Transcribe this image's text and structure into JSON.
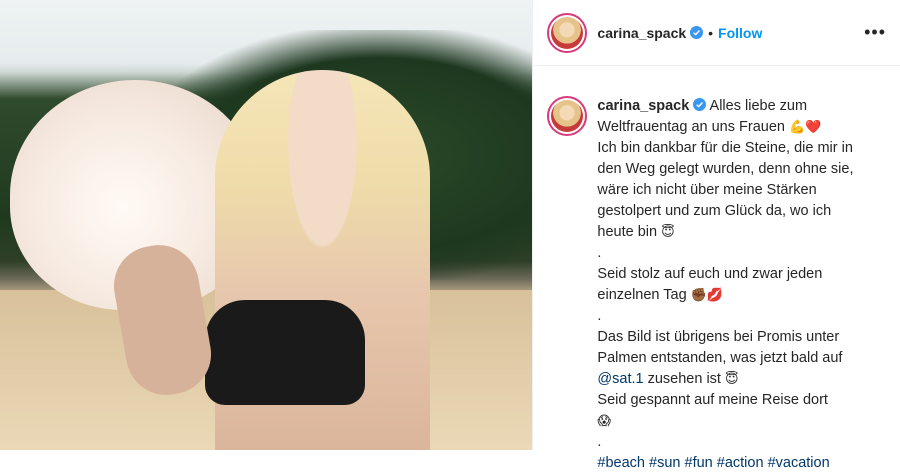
{
  "post": {
    "username": "carina_spack",
    "separator": "•",
    "follow_label": "Follow",
    "more_icon": "more-options-icon",
    "more_glyph": "•••"
  },
  "caption": {
    "username": "carina_spack",
    "line1": " Alles liebe zum Weltfrauentag an uns Frauen ",
    "line1_emoji": "💪❤️",
    "line2": "Ich bin dankbar für die Steine, die mir in den Weg gelegt wurden, denn ohne sie, wäre ich nicht über meine Stärken gestolpert und zum Glück da, wo ich heute bin ",
    "line2_emoji": "😇",
    "dot1": ".",
    "line3": "Seid stolz auf euch und zwar jeden einzelnen Tag ",
    "line3_emoji": "✊🏾💋",
    "dot2": ".",
    "line4a": "Das Bild ist übrigens bei Promis unter Palmen entstanden, was jetzt bald auf ",
    "mention": "@sat.1",
    "line4b": " zusehen ist ",
    "line4_emoji": "😇",
    "line5": "Seid gespannt auf meine Reise dort",
    "line5_emoji": "😱",
    "dot3": ".",
    "hashtags": [
      "#beach",
      "#sun",
      "#fun",
      "#action",
      "#vacation"
    ]
  },
  "colors": {
    "accent": "#0095f6",
    "link": "#00376b",
    "text": "#262626"
  }
}
